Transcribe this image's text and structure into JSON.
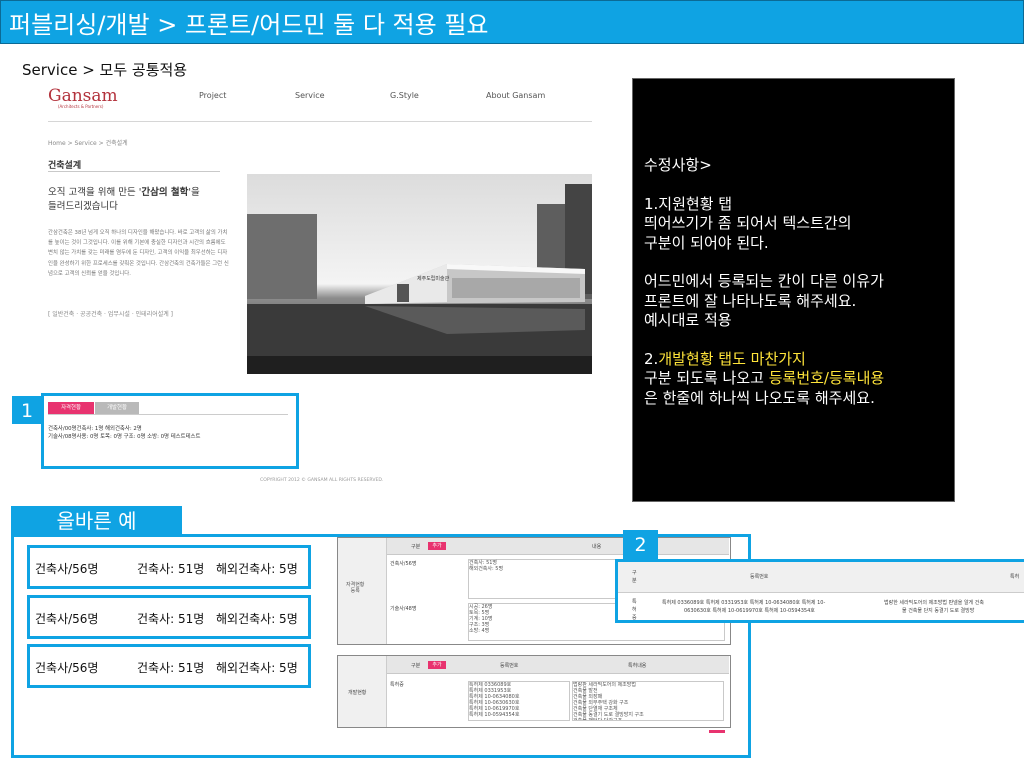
{
  "header": {
    "title": "퍼블리싱/개발 > 프론트/어드민 둘 다 적용 필요"
  },
  "breadcrumb_line": "Service > 모두 공통적용",
  "site": {
    "logo": "Gansam",
    "logo_sub": "(Architects & Partners)",
    "nav": [
      "Project",
      "Service",
      "G.Style",
      "About Gansam"
    ],
    "page_path": "Home > Service > 건축설계",
    "page_heading": "건축설계",
    "intro_heading_plain": "오직 고객을 위해 만든 '",
    "intro_heading_bold": "간삼의 철학",
    "intro_heading_after": "'을",
    "intro_heading_line2": "들려드리겠습니다",
    "intro_body": "간삼건축은 38년 넘게 오직 하나의 디자인을 해왔습니다. 바로 고객의 삶의 가치를 높이는 것이 그것입니다. 이를 위해 기본에 충실한 디자인과 시간의 흐름에도 변치 않는 가치를 갖는 미래를 염두에 둔 디자인, 고객의 이익을 최우선하는 디자인을 완성하기 위한 프로세스를 갖춰온 것입니다. 간삼건축의 건축가들은 그런 신념으로 고객의 신뢰를 얻을 것입니다.",
    "project_tags": "[ 일반건축 · 공공건축 · 업무시설 · 인테리어설계 ]",
    "building_sign": "제주도립미술관",
    "footer": "COPYRIGHT 2012 © GANSAM ALL RIGHTS RESERVED."
  },
  "callout1": {
    "number": "1",
    "tab_license": "자격현황",
    "tab_dev": "개발현황",
    "line1": "건축사/00명건축사: 1명 해외건축사: 2명",
    "line2": "기술사/08명사용: 0명 토목: 0명 구조: 0명 소방: 0명 테스트테스트"
  },
  "memo": {
    "title": "수정사항>",
    "item1_title": "1.지원현황 탭",
    "item1_line1": "띄어쓰기가 좀 되어서 텍스트간의",
    "item1_line2": "구분이 되어야 된다.",
    "item1_line3": "어드민에서 등록되는 칸이 다른 이유가",
    "item1_line4": "프론트에 잘 나타나도록 해주세요.",
    "item1_line5": "예시대로 적용",
    "item2_prefix": "2.",
    "item2_highlight": "개발현황 탭도 마찬가지",
    "item2_line1_plain": "구분 되도록 나오고 ",
    "item2_line1_highlight": "등록번호/등록내용",
    "item2_line2": "은 한줄에 하나씩 나오도록 해주세요."
  },
  "example": {
    "label": "올바른 예",
    "rows": [
      {
        "a": "건축사/56명",
        "b": "건축사: 51명",
        "c": "해외건축사: 5명"
      },
      {
        "a": "건축사/56명",
        "b": "건축사: 51명",
        "c": "해외건축사: 5명"
      },
      {
        "a": "건축사/56명",
        "b": "건축사: 51명",
        "c": "해외건축사: 5명"
      }
    ]
  },
  "admin_license": {
    "row_label": "자격현황\n등록",
    "col_gubun": "구분",
    "col_content": "내용",
    "add": "추가",
    "row1_gubun": "건축사/56명",
    "row1_content": "건축사: 51명\n해외건축사: 5명",
    "row2_gubun": "기술사/48명",
    "row2_content": "시공: 26명\n토목: 5명\n기계: 10명\n구조: 3명\n소방: 4명"
  },
  "admin_dev": {
    "row_label": "개발현황",
    "col_gubun": "구분",
    "col_regno": "등록번호",
    "col_content": "특허내용",
    "add": "추가",
    "gubun_value": "특허증",
    "regno": "특허제 0336089호\n특허제 0331953호\n특허제 10-0634080호\n특허제 10-0630630호\n특허제 10-0619970호\n특허제 10-0594354호",
    "content": "법랑판 세라믹도어의 제조방법\n건축물 발전\n건축물 외장패\n건축물 외부주택 강화 구조\n건축물 단열재 구조체\n건축물 동결기 도로 결빙방지 구조\n건축물 패턴다 단간구조"
  },
  "callout2": {
    "number": "2",
    "col_gubun": "구분",
    "col_regno": "등록번호",
    "col_content": "특허",
    "gubun_value": "특허증",
    "regno_line1": "특허제 0336089호 특허제 0331953호 특허제 10-0634080호 특허제 10-",
    "regno_line2": "0630630호 특허제 10-0619970호 특허제 10-0594354호",
    "content_line1": "법랑한 세라믹도어의 제조방법 판넬을 알게 건축",
    "content_line2": "물 건축물 단지 동결기 도로 결빙방"
  }
}
